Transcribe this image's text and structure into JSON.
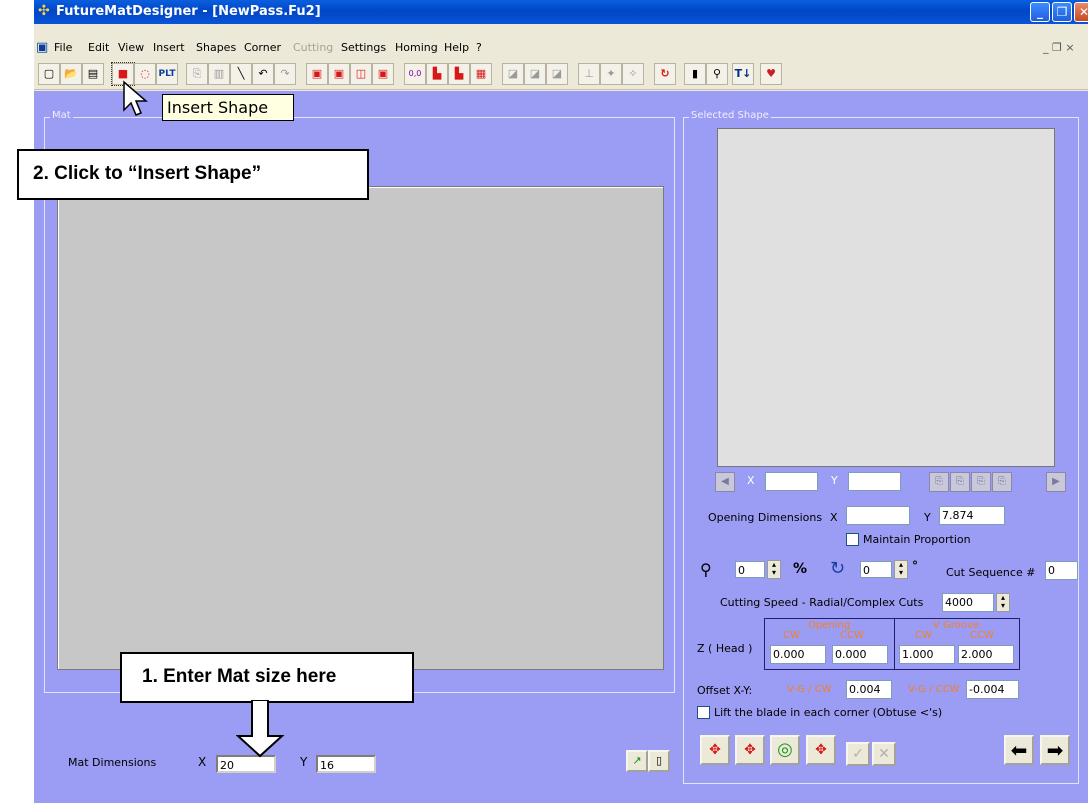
{
  "window": {
    "title": "FutureMatDesigner - [NewPass.Fu2]",
    "minimize_glyph": "_",
    "restore_glyph": "❐",
    "close_glyph": "✕"
  },
  "menu": {
    "items": [
      {
        "label": "File"
      },
      {
        "label": "Edit"
      },
      {
        "label": "View"
      },
      {
        "label": "Insert"
      },
      {
        "label": "Shapes"
      },
      {
        "label": "Corner"
      },
      {
        "label": "Cutting",
        "disabled": true
      },
      {
        "label": "Settings"
      },
      {
        "label": "Homing"
      },
      {
        "label": "Help"
      },
      {
        "label": "?"
      }
    ],
    "right_controls": "_ ❐ ×"
  },
  "toolbar": {
    "tooltip": "Insert Shape",
    "plt_label": "PLT",
    "origin_label": "0,0",
    "ti_label": "T↓"
  },
  "mat_panel": {
    "label": "Mat"
  },
  "callouts": {
    "insert_shape": "2. Click to “Insert Shape”",
    "mat_size": "1. Enter Mat size here"
  },
  "mat_dimensions": {
    "label": "Mat Dimensions",
    "x_label": "X",
    "x_value": "20",
    "y_label": "Y",
    "y_value": "16"
  },
  "selected_shape": {
    "label": "Selected Shape",
    "nav_x_label": "X",
    "nav_y_label": "Y",
    "nav_x_value": "",
    "nav_y_value": "",
    "opening_dimensions_label": "Opening Dimensions",
    "opening_x_label": "X",
    "opening_x_value": "",
    "opening_y_label": "Y",
    "opening_y_value": "7.874",
    "maintain_proportion_label": "Maintain Proportion",
    "zoom_value": "0",
    "percent_label": "%",
    "rotate_value": "0",
    "degree_label": "°",
    "cut_sequence_label": "Cut Sequence #",
    "cut_sequence_value": "0",
    "cutting_speed_label": "Cutting Speed - Radial/Complex Cuts",
    "cutting_speed_value": "4000",
    "z_head_label": "Z  ( Head )",
    "opening_label": "Opening",
    "vgroove_label": "V Groove",
    "cw_label": "CW",
    "ccw_label": "CCW",
    "opening_cw": "0.000",
    "opening_ccw": "0.000",
    "vgroove_cw": "1.000",
    "vgroove_ccw": "2.000",
    "offset_label": "Offset X-Y:",
    "vg_cw_label": "V-G / CW",
    "vg_cw_value": "0.004",
    "vg_ccw_label": "V-G / CCW",
    "vg_ccw_value": "-0.004",
    "lift_blade_label": "Lift the blade in each corner (Obtuse <'s)"
  },
  "colors": {
    "client_bg": "#9B9CF3",
    "title_blue": "#0A5FDE",
    "orange_label": "#F57F2A"
  }
}
